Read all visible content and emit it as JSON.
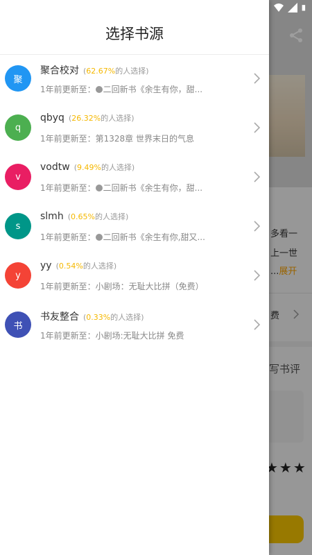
{
  "drawer": {
    "title": "选择书源"
  },
  "sources": [
    {
      "avatar": "聚",
      "color": "#2196f3",
      "name": "聚合校对",
      "percent": "62.67%",
      "suffix": "的人选择)",
      "prefix": "(",
      "update_label": "1年前更新至：",
      "update_dot": true,
      "update_text": "二回新书《余生有你，甜..."
    },
    {
      "avatar": "q",
      "color": "#4caf50",
      "name": "qbyq",
      "percent": "26.32%",
      "suffix": "的人选择)",
      "prefix": "(",
      "update_label": "1年前更新至：",
      "update_dot": false,
      "update_text": "第1328章 世界末日的气息"
    },
    {
      "avatar": "v",
      "color": "#e91e63",
      "name": "vodtw",
      "percent": "9.49%",
      "suffix": "的人选择)",
      "prefix": "(",
      "update_label": "1年前更新至：",
      "update_dot": true,
      "update_text": "二回新书《余生有你，甜..."
    },
    {
      "avatar": "s",
      "color": "#009688",
      "name": "slmh",
      "percent": "0.65%",
      "suffix": "的人选择)",
      "prefix": "(",
      "update_label": "1年前更新至：",
      "update_dot": true,
      "update_text": "二回新书《余生有你,甜又..."
    },
    {
      "avatar": "y",
      "color": "#f44336",
      "name": "yy",
      "percent": "0.54%",
      "suffix": "的人选择)",
      "prefix": "(",
      "update_label": "1年前更新至：",
      "update_dot": false,
      "update_text": "小剧场：无耻大比拼（免费）"
    },
    {
      "avatar": "书",
      "color": "#3f51b5",
      "name": "书友整合",
      "percent": "0.33%",
      "suffix": "的人选择)",
      "prefix": "(",
      "update_label": "1年前更新至：",
      "update_dot": false,
      "update_text": "小剧场:无耻大比拼 免费"
    }
  ],
  "background": {
    "desc_line1": "多看一",
    "desc_line2": "上一世",
    "desc_line3_prefix": "...",
    "expand": "展开",
    "fee": "费",
    "write_review": "写书评",
    "stars": "★★★"
  }
}
